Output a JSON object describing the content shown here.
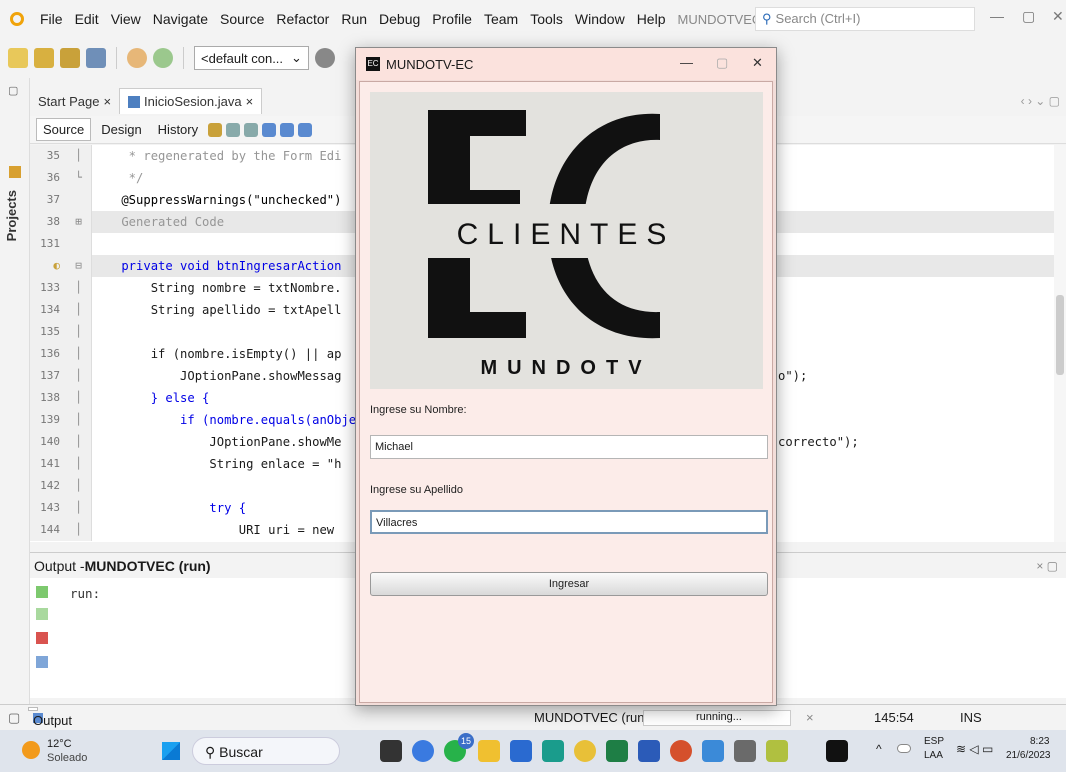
{
  "menubar": {
    "items": [
      "File",
      "Edit",
      "View",
      "Navigate",
      "Source",
      "Refactor",
      "Run",
      "Debug",
      "Profile",
      "Team",
      "Tools",
      "Window",
      "Help"
    ],
    "app_title": "MUNDOTVEC - Ap...",
    "search_placeholder": "Search (Ctrl+I)"
  },
  "toolbar": {
    "config": "<default con..."
  },
  "left_strip": {
    "projects": "Projects"
  },
  "tabs": [
    {
      "label": "Start Page",
      "close": "×"
    },
    {
      "label": "InicioSesion.java",
      "close": "×"
    }
  ],
  "editor_toolbar": {
    "source": "Source",
    "design": "Design",
    "history": "History"
  },
  "code": {
    "lines": [
      {
        "num": "35",
        "text": "     * regenerated by the Form Edi"
      },
      {
        "num": "36",
        "text": "     */"
      },
      {
        "num": "37",
        "text": "    @SuppressWarnings(\"unchecked\")"
      },
      {
        "num": "38",
        "text": "    Generated Code"
      },
      {
        "num": "131",
        "text": ""
      },
      {
        "num": "",
        "text": "    private void btnIngresarAction"
      },
      {
        "num": "133",
        "text": "        String nombre = txtNombre."
      },
      {
        "num": "134",
        "text": "        String apellido = txtApell"
      },
      {
        "num": "135",
        "text": ""
      },
      {
        "num": "136",
        "text": "        if (nombre.isEmpty() || ap"
      },
      {
        "num": "137",
        "text": "            JOptionPane.showMessag"
      },
      {
        "num": "138",
        "text": "        } else {"
      },
      {
        "num": "139",
        "text": "            if (nombre.equals(anObje"
      },
      {
        "num": "140",
        "text": "                JOptionPane.showMe"
      },
      {
        "num": "141",
        "text": "                String enlace = \"h"
      },
      {
        "num": "142",
        "text": ""
      },
      {
        "num": "143",
        "text": "                try {"
      },
      {
        "num": "144",
        "text": "                    URI uri = new"
      }
    ],
    "right_fragments": {
      "l137": "o\");",
      "l140": "correcto\");"
    }
  },
  "output": {
    "label": "Output - ",
    "project": "MUNDOTVEC (run)",
    "run_text": "run:"
  },
  "statusbar": {
    "output_tab": "Output",
    "process": "MUNDOTVEC (run)",
    "state": "running...",
    "close": "×",
    "position": "145:54",
    "mode": "INS"
  },
  "taskbar": {
    "temp": "12°C",
    "weather": "Soleado",
    "search": "Buscar",
    "lang1": "ESP",
    "lang2": "LAA",
    "time": "8:23",
    "date": "21/6/2023",
    "badge": "15"
  },
  "dialog": {
    "title": "MUNDOTV-EC",
    "logo_letters": "EC",
    "logo_main": "CLIENTES",
    "logo_sub": "MUNDOTV",
    "label_nombre": "Ingrese su Nombre:",
    "nombre_value": "Michael",
    "label_apellido": "Ingrese su Apellido",
    "apellido_value": "Villacres",
    "button": "Ingresar"
  }
}
